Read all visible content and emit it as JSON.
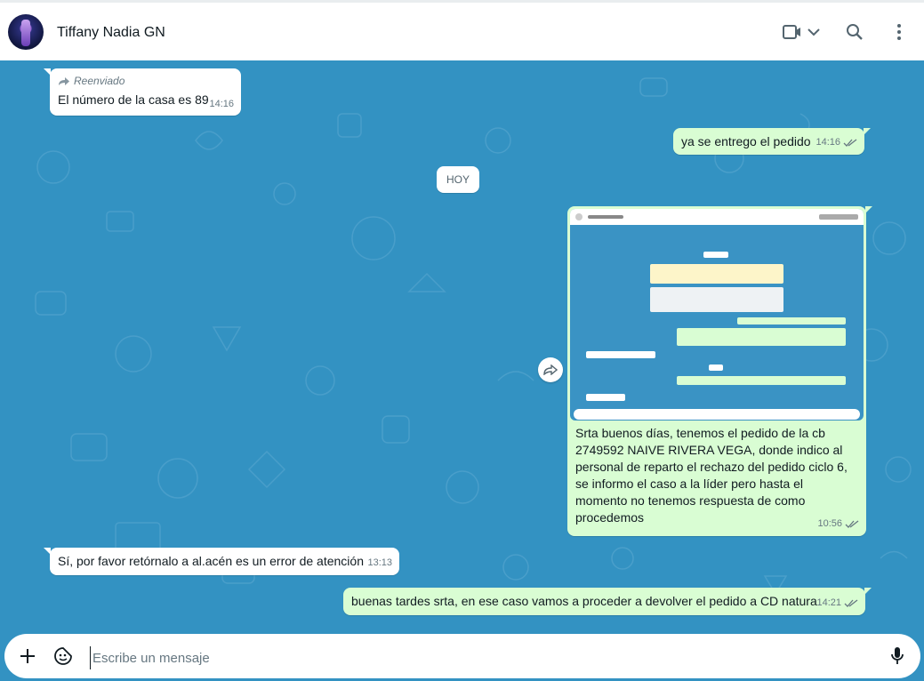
{
  "header": {
    "contact_name": "Tiffany Nadia GN",
    "icons": [
      "video-call-icon",
      "chevron-down-icon",
      "search-icon",
      "menu-dots-icon"
    ]
  },
  "day_separator": "HOY",
  "messages": [
    {
      "direction": "in",
      "forwarded_label": "Reenviado",
      "text": "El número de la casa es 89",
      "time": "14:16"
    },
    {
      "direction": "out",
      "text": "ya se entrego el pedido",
      "time": "14:16",
      "status": "read"
    },
    {
      "direction": "out",
      "type": "image",
      "caption": "Srta buenos días, tenemos el pedido de la cb 2749592 NAIVE RIVERA VEGA, donde  indico al personal de reparto el rechazo del pedido ciclo 6, se informo el caso a la líder pero hasta el momento no tenemos respuesta de como procedemos",
      "time": "10:56",
      "status": "read"
    },
    {
      "direction": "in",
      "text": "Sí, por favor retórnalo a al.acén es un error de atención",
      "time": "13:13"
    },
    {
      "direction": "out",
      "text": "buenas tardes srta, en ese caso vamos a proceder a devolver el pedido a CD natura",
      "time": "14:21",
      "status": "read"
    }
  ],
  "composer": {
    "placeholder": "Escribe un mensaje",
    "icons": [
      "plus-icon",
      "sticker-icon",
      "microphone-icon"
    ]
  },
  "colors": {
    "chat_background": "#3392c2",
    "outgoing_bubble": "#d9fdd3",
    "incoming_bubble": "#ffffff"
  }
}
